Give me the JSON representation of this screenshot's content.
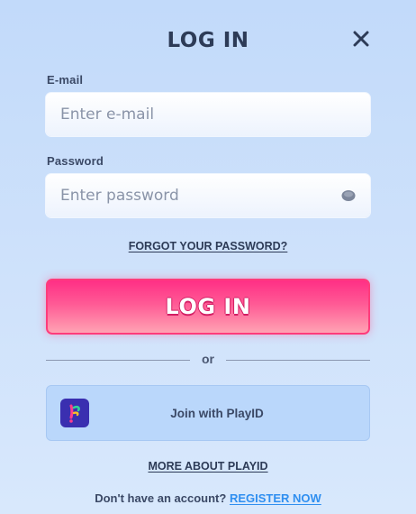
{
  "header": {
    "title": "LOG IN"
  },
  "email": {
    "label": "E-mail",
    "placeholder": "Enter e-mail",
    "value": ""
  },
  "password": {
    "label": "Password",
    "placeholder": "Enter password",
    "value": "",
    "toggle_icon": "eye-icon"
  },
  "links": {
    "forgot_password": "FORGOT YOUR PASSWORD?",
    "more_about_playid": "MORE ABOUT PLAYID"
  },
  "login_button": {
    "label": "LOG IN"
  },
  "divider": {
    "text": "or"
  },
  "playid": {
    "label": "Join with PlayID",
    "icon": "playid-logo-icon"
  },
  "register": {
    "prompt": "Don't have an account?",
    "link": "REGISTER NOW"
  },
  "colors": {
    "primary_button": "#ff3c7c",
    "link_blue": "#2f8ff0",
    "text_dark": "#2d3b57",
    "background": "#c2dafa"
  }
}
